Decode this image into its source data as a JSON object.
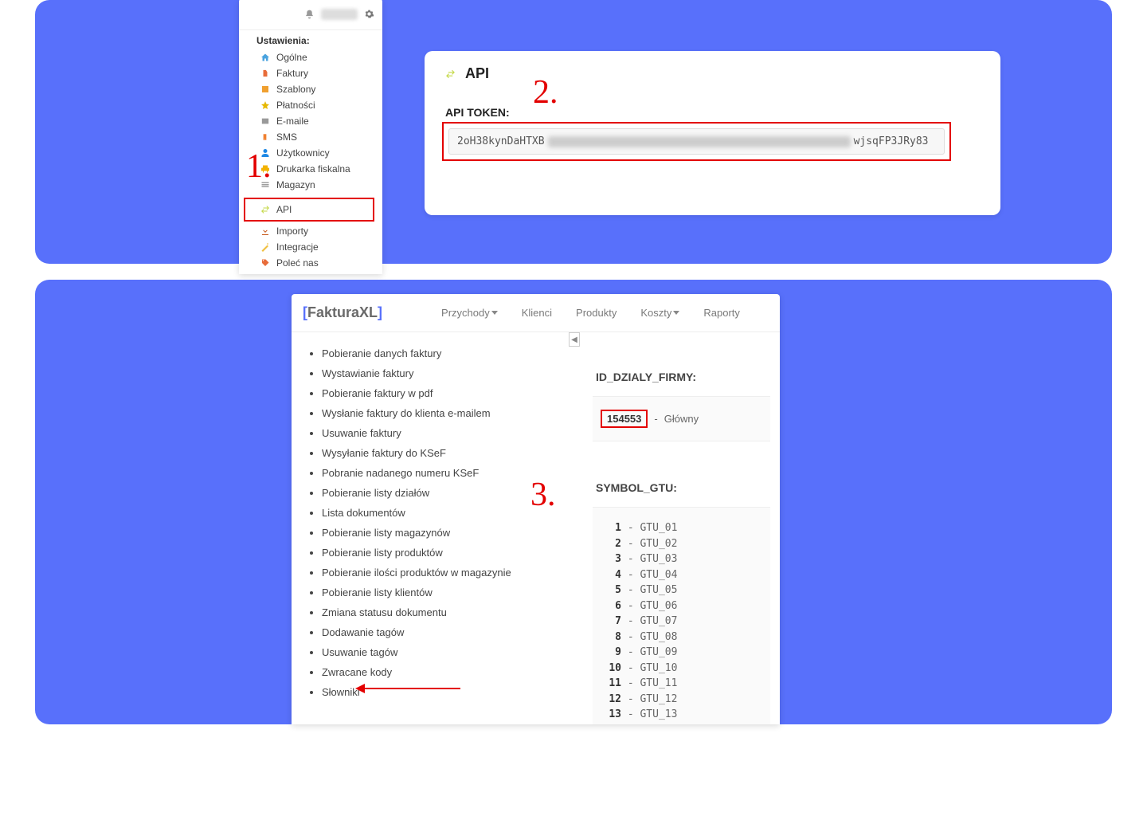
{
  "callouts": {
    "one": "1.",
    "two": "2.",
    "three": "3."
  },
  "settings_menu": {
    "heading": "Ustawienia:",
    "items": [
      {
        "label": "Ogólne",
        "icon": "home-icon",
        "color": "#4aa3df"
      },
      {
        "label": "Faktury",
        "icon": "file-icon",
        "color": "#e86c3a"
      },
      {
        "label": "Szablony",
        "icon": "image-icon",
        "color": "#f0a030"
      },
      {
        "label": "Płatności",
        "icon": "star-icon",
        "color": "#e6b800"
      },
      {
        "label": "E-maile",
        "icon": "mail-icon",
        "color": "#999999"
      },
      {
        "label": "SMS",
        "icon": "phone-icon",
        "color": "#f08030"
      },
      {
        "label": "Użytkownicy",
        "icon": "user-icon",
        "color": "#1e88e5"
      },
      {
        "label": "Drukarka fiskalna",
        "icon": "printer-icon",
        "color": "#f3b300"
      },
      {
        "label": "Magazyn",
        "icon": "stack-icon",
        "color": "#9e9e9e"
      },
      {
        "label": "API",
        "icon": "swap-icon",
        "color": "#c5d94a",
        "highlighted": true
      },
      {
        "label": "Importy",
        "icon": "download-icon",
        "color": "#c75b1e"
      },
      {
        "label": "Integracje",
        "icon": "wand-icon",
        "color": "#f0c040"
      },
      {
        "label": "Poleć nas",
        "icon": "tag-icon",
        "color": "#e86c3a"
      }
    ]
  },
  "api_panel": {
    "heading": "API",
    "token_label": "API TOKEN:",
    "token_prefix": "2oH38kynDaHTXB",
    "token_suffix": "wjsqFP3JRy83"
  },
  "app": {
    "logo": {
      "open": "[",
      "name": "FakturaXL",
      "close": "]"
    },
    "nav": [
      {
        "label": "Przychody",
        "caret": true
      },
      {
        "label": "Klienci",
        "caret": false
      },
      {
        "label": "Produkty",
        "caret": false
      },
      {
        "label": "Koszty",
        "caret": true
      },
      {
        "label": "Raporty",
        "caret": false
      }
    ],
    "docs": [
      "Pobieranie danych faktury",
      "Wystawianie faktury",
      "Pobieranie faktury w pdf",
      "Wysłanie faktury do klienta e-mailem",
      "Usuwanie faktury",
      "Wysyłanie faktury do KSeF",
      "Pobranie nadanego numeru KSeF",
      "Pobieranie listy działów",
      "Lista dokumentów",
      "Pobieranie listy magazynów",
      "Pobieranie listy produktów",
      "Pobieranie ilości produktów w magazynie",
      "Pobieranie listy klientów",
      "Zmiana statusu dokumentu",
      "Dodawanie tagów",
      "Usuwanie tagów",
      "Zwracane kody",
      "Słowniki"
    ],
    "dzialy": {
      "label": "ID_DZIALY_FIRMY:",
      "id": "154553",
      "sep": "-",
      "name": "Główny"
    },
    "gtu": {
      "label": "SYMBOL_GTU:",
      "rows": [
        {
          "n": "1",
          "c": "GTU_01"
        },
        {
          "n": "2",
          "c": "GTU_02"
        },
        {
          "n": "3",
          "c": "GTU_03"
        },
        {
          "n": "4",
          "c": "GTU_04"
        },
        {
          "n": "5",
          "c": "GTU_05"
        },
        {
          "n": "6",
          "c": "GTU_06"
        },
        {
          "n": "7",
          "c": "GTU_07"
        },
        {
          "n": "8",
          "c": "GTU_08"
        },
        {
          "n": "9",
          "c": "GTU_09"
        },
        {
          "n": "10",
          "c": "GTU_10"
        },
        {
          "n": "11",
          "c": "GTU_11"
        },
        {
          "n": "12",
          "c": "GTU_12"
        },
        {
          "n": "13",
          "c": "GTU_13"
        }
      ]
    }
  }
}
